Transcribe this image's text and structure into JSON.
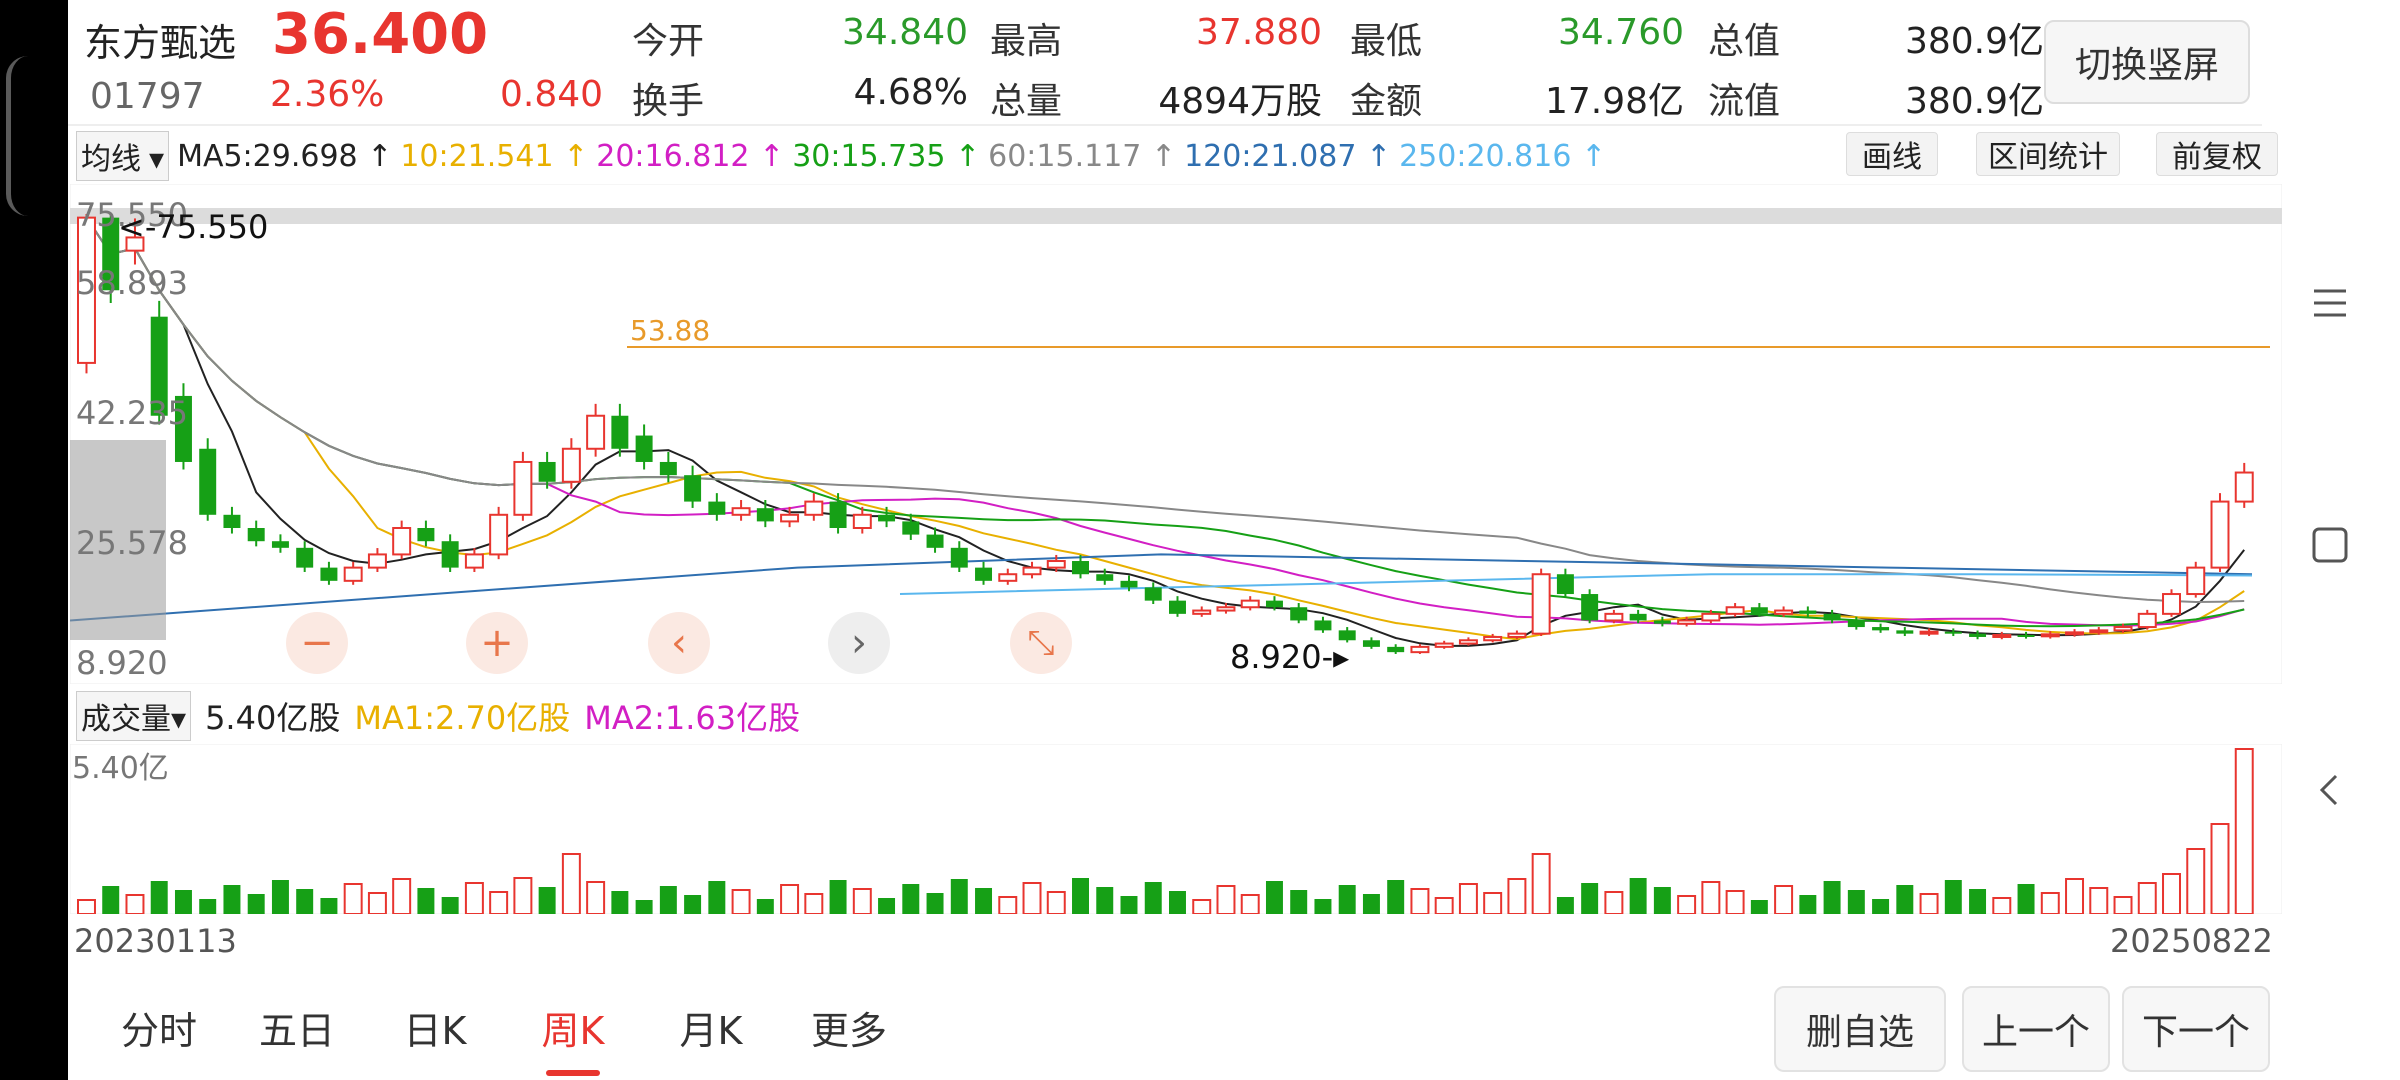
{
  "header": {
    "stock_name": "东方甄选",
    "price": "36.400",
    "code": "01797",
    "change_pct": "2.36%",
    "change_amt": "0.840",
    "stats": [
      {
        "label": "今开",
        "value": "34.840",
        "color": "green"
      },
      {
        "label": "最高",
        "value": "37.880",
        "color": "red"
      },
      {
        "label": "最低",
        "value": "34.760",
        "color": "green"
      },
      {
        "label": "总值",
        "value": "380.9亿",
        "color": "dark"
      },
      {
        "label": "换手",
        "value": "4.68%",
        "color": "dark"
      },
      {
        "label": "总量",
        "value": "4894万股",
        "color": "dark"
      },
      {
        "label": "金额",
        "value": "17.98亿",
        "color": "dark"
      },
      {
        "label": "流值",
        "value": "380.9亿",
        "color": "dark"
      }
    ],
    "switch_button": "切换竖屏"
  },
  "ma_bar": {
    "selector": "均线",
    "items": [
      {
        "text": "MA5:29.698 ↑",
        "color": "#222222"
      },
      {
        "text": "10:21.541 ↑",
        "color": "#e8b000"
      },
      {
        "text": "20:16.812 ↑",
        "color": "#d21fc4"
      },
      {
        "text": "30:15.735 ↑",
        "color": "#16a016"
      },
      {
        "text": "60:15.117 ↑",
        "color": "#888888"
      },
      {
        "text": "120:21.087 ↑",
        "color": "#2f6fb0"
      },
      {
        "text": "250:20.816 ↑",
        "color": "#5ab7ee"
      }
    ],
    "buttons": [
      "画线",
      "区间统计",
      "前复权"
    ]
  },
  "price_axis": {
    "ticks": [
      "75.550",
      "58.893",
      "42.235",
      "25.578",
      "8.920"
    ]
  },
  "chart_annotations": {
    "high_marker": "75.550",
    "low_marker": "8.920",
    "level_line": "53.88"
  },
  "volume_bar": {
    "selector": "成交量",
    "value": "5.40亿股",
    "ma1": "MA1:2.70亿股",
    "ma2": "MA2:1.63亿股",
    "axis_top": "5.40亿"
  },
  "dates": {
    "start": "20230113",
    "end": "20250822"
  },
  "tabs": [
    "分时",
    "五日",
    "日K",
    "周K",
    "月K",
    "更多"
  ],
  "active_tab": "周K",
  "bottom_buttons": [
    "删自选",
    "上一个",
    "下一个"
  ],
  "colors": {
    "up": "#e8352f",
    "down": "#16a016",
    "ma5": "#222222",
    "ma10": "#e8b000",
    "ma20": "#d21fc4",
    "ma30": "#16a016",
    "ma60": "#888888",
    "ma120": "#2f6fb0",
    "ma250": "#5ab7ee",
    "level_line": "#e89a2a"
  },
  "chart_data": {
    "type": "candlestick",
    "period": "weekly",
    "x_range": [
      "20230113",
      "20250822"
    ],
    "ylim": [
      8.92,
      75.55
    ],
    "high": 75.55,
    "low": 8.92,
    "reference_line": 53.88,
    "candles_approx": [
      [
        53,
        75
      ],
      [
        75,
        64
      ],
      [
        70,
        72
      ],
      [
        60,
        45
      ],
      [
        48,
        38
      ],
      [
        40,
        30
      ],
      [
        30,
        28
      ],
      [
        28,
        26
      ],
      [
        26,
        25
      ],
      [
        25,
        22
      ],
      [
        22,
        20
      ],
      [
        20,
        22
      ],
      [
        22,
        24
      ],
      [
        24,
        28
      ],
      [
        28,
        26
      ],
      [
        26,
        22
      ],
      [
        22,
        24
      ],
      [
        24,
        30
      ],
      [
        30,
        38
      ],
      [
        38,
        35
      ],
      [
        35,
        40
      ],
      [
        40,
        45
      ],
      [
        45,
        40
      ],
      [
        42,
        38
      ],
      [
        38,
        36
      ],
      [
        36,
        32
      ],
      [
        32,
        30
      ],
      [
        30,
        31
      ],
      [
        31,
        29
      ],
      [
        29,
        30
      ],
      [
        30,
        32
      ],
      [
        32,
        28
      ],
      [
        28,
        30
      ],
      [
        30,
        29
      ],
      [
        29,
        27
      ],
      [
        27,
        25
      ],
      [
        25,
        22
      ],
      [
        22,
        20
      ],
      [
        20,
        21
      ],
      [
        21,
        22
      ],
      [
        22,
        23
      ],
      [
        23,
        21
      ],
      [
        21,
        20
      ],
      [
        20,
        19
      ],
      [
        19,
        17
      ],
      [
        17,
        15
      ],
      [
        15,
        15.5
      ],
      [
        15.5,
        16
      ],
      [
        16,
        17
      ],
      [
        17,
        16
      ],
      [
        16,
        14
      ],
      [
        14,
        12.5
      ],
      [
        12.5,
        11
      ],
      [
        11,
        10
      ],
      [
        10,
        9.2
      ],
      [
        9.2,
        10
      ],
      [
        10,
        10.5
      ],
      [
        10.5,
        11
      ],
      [
        11,
        11.5
      ],
      [
        11.5,
        12
      ],
      [
        12,
        21
      ],
      [
        21,
        18
      ],
      [
        18,
        14
      ],
      [
        14,
        15
      ],
      [
        15,
        14
      ],
      [
        14,
        13.5
      ],
      [
        13.5,
        14
      ],
      [
        14,
        15
      ],
      [
        15,
        16
      ],
      [
        16,
        15
      ],
      [
        15,
        15.5
      ],
      [
        15.5,
        15
      ],
      [
        15,
        14
      ],
      [
        14,
        13
      ],
      [
        13,
        12.5
      ],
      [
        12.5,
        12
      ],
      [
        12,
        12.3
      ],
      [
        12.3,
        12
      ],
      [
        12,
        11.5
      ],
      [
        11.5,
        11.8
      ],
      [
        11.8,
        11.6
      ],
      [
        11.6,
        11.9
      ],
      [
        11.9,
        12.2
      ],
      [
        12.2,
        12.5
      ],
      [
        12.5,
        13
      ],
      [
        13,
        15
      ],
      [
        15,
        18
      ],
      [
        18,
        22
      ],
      [
        22,
        32
      ],
      [
        32,
        36.4
      ]
    ],
    "volume_max": "5.40亿"
  }
}
